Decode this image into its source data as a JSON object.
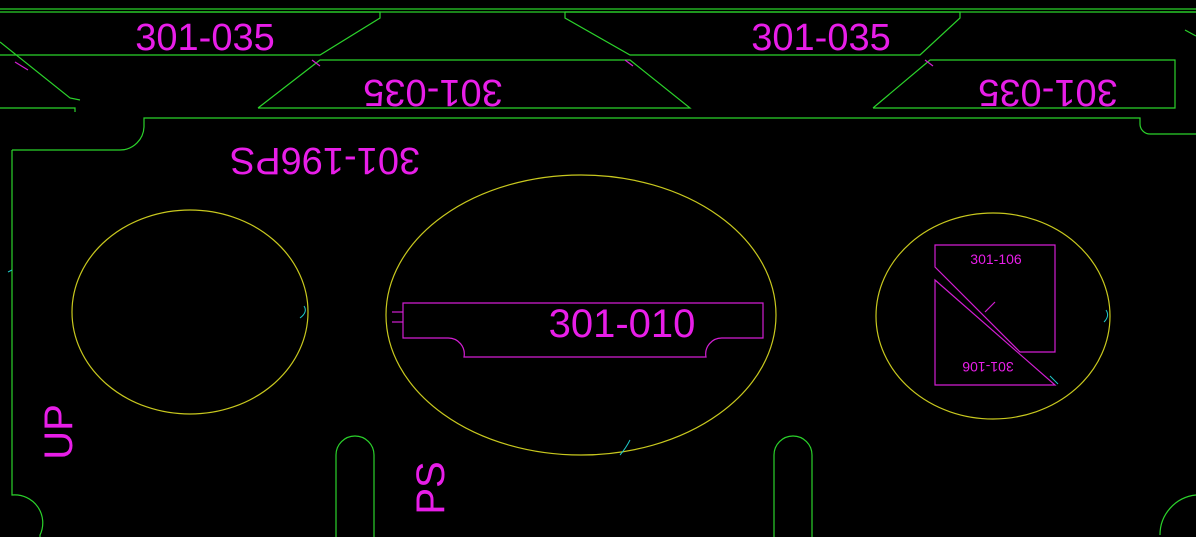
{
  "colors": {
    "background": "#000000",
    "sheet_outline": "#2bd22b",
    "cut_circle": "#c8c81e",
    "part_outline": "#d21ed2",
    "marker": "#1ec8c8",
    "label": "#e81ee8"
  },
  "labels": {
    "top_left_upper": "301-035",
    "top_right_upper": "301-035",
    "top_left_lower": "301-035",
    "top_right_lower": "301-035",
    "plate_id": "301-196PS",
    "slot_part": "301-010",
    "tri_upper": "301-106",
    "tri_lower": "301-106",
    "up_mark": "UP",
    "ps_mark": "PS"
  }
}
